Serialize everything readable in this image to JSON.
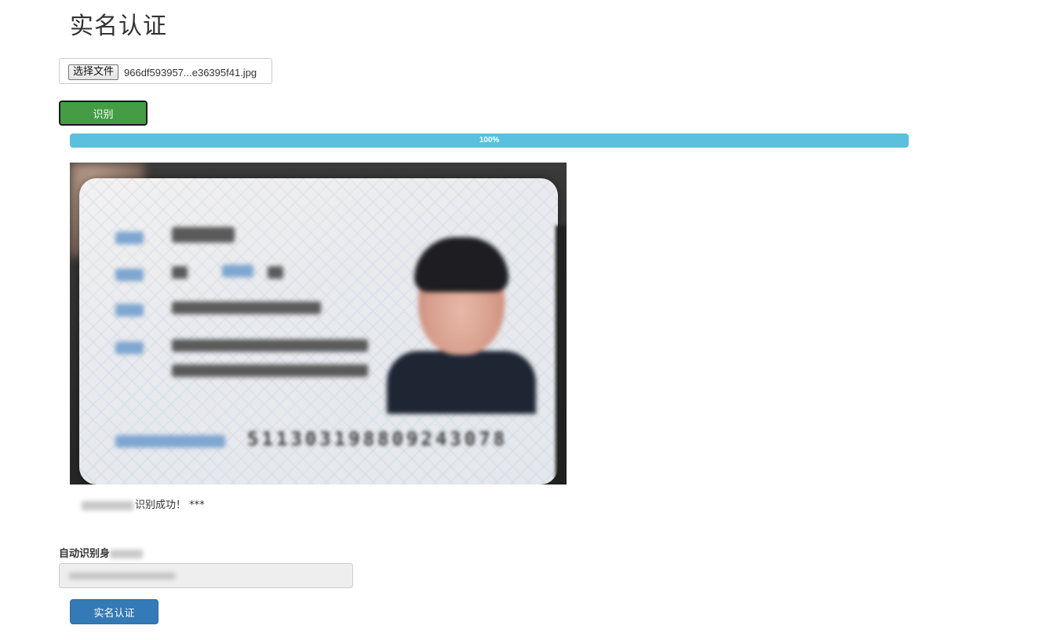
{
  "page": {
    "title": "实名认证"
  },
  "upload": {
    "button_label": "选择文件",
    "file_name": "966df593957...e36395f41.jpg"
  },
  "recognize": {
    "button_label": "识别"
  },
  "progress": {
    "value": 100,
    "label": "100%",
    "color": "#5bc0de"
  },
  "photo": {
    "id_number": "511303198809243078"
  },
  "result": {
    "message": "识别成功！ ***"
  },
  "id_field": {
    "label": "自动识别身"
  },
  "submit": {
    "button_label": "实名认证",
    "color": "#337ab7"
  }
}
